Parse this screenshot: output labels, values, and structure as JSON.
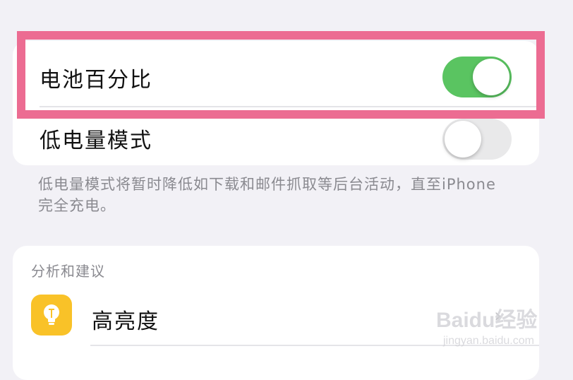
{
  "battery_settings": {
    "battery_percentage": {
      "label": "电池百分比",
      "enabled": true
    },
    "low_power_mode": {
      "label": "低电量模式",
      "enabled": false
    },
    "footnote": "低电量模式将暂时降低如下载和邮件抓取等后台活动，直至iPhone完全充电。"
  },
  "insights": {
    "section_header": "分析和建议",
    "brightness": {
      "label": "高亮度",
      "icon": "lightbulb-icon"
    }
  },
  "watermark": {
    "text": "Baidu经验",
    "url_text": "jingyan.baidu.com"
  },
  "colors": {
    "toggle_on": "#5ac461",
    "highlight": "#ec6c92",
    "icon_bg": "#f9c228"
  }
}
